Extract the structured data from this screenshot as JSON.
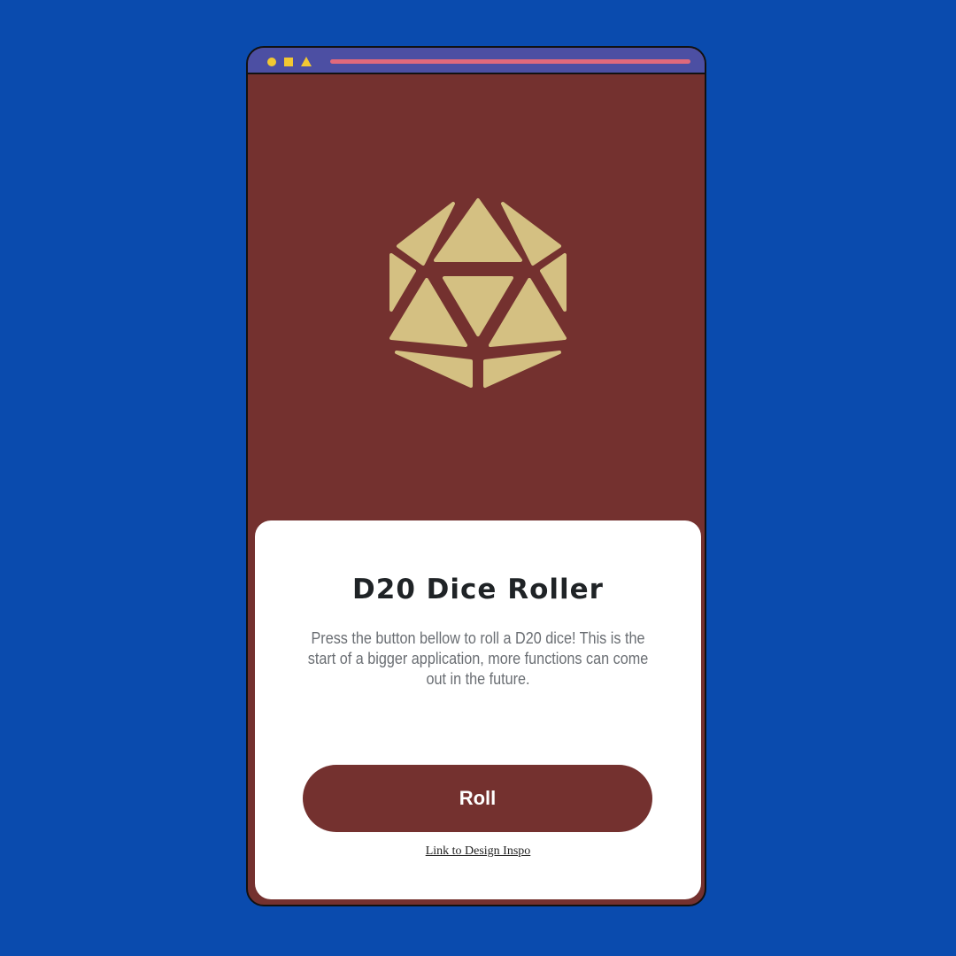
{
  "window": {
    "controls": [
      "circle",
      "square",
      "triangle"
    ],
    "control_color": "#f1c832",
    "titlebar_color": "#4c4fa3",
    "address_bar_color": "#e0697c"
  },
  "logo": {
    "icon": "d20-die-icon",
    "color": "#d4c082"
  },
  "card": {
    "title": "D20 Dice Roller",
    "description": "Press the button bellow to roll a D20 dice! This is the start of a bigger application, more functions can come out in the future.",
    "roll_label": "Roll",
    "link_text": "Link to Design Inspo"
  },
  "colors": {
    "background": "#0a4bae",
    "app_background": "#74312f",
    "card": "#ffffff",
    "button": "#74312f"
  }
}
